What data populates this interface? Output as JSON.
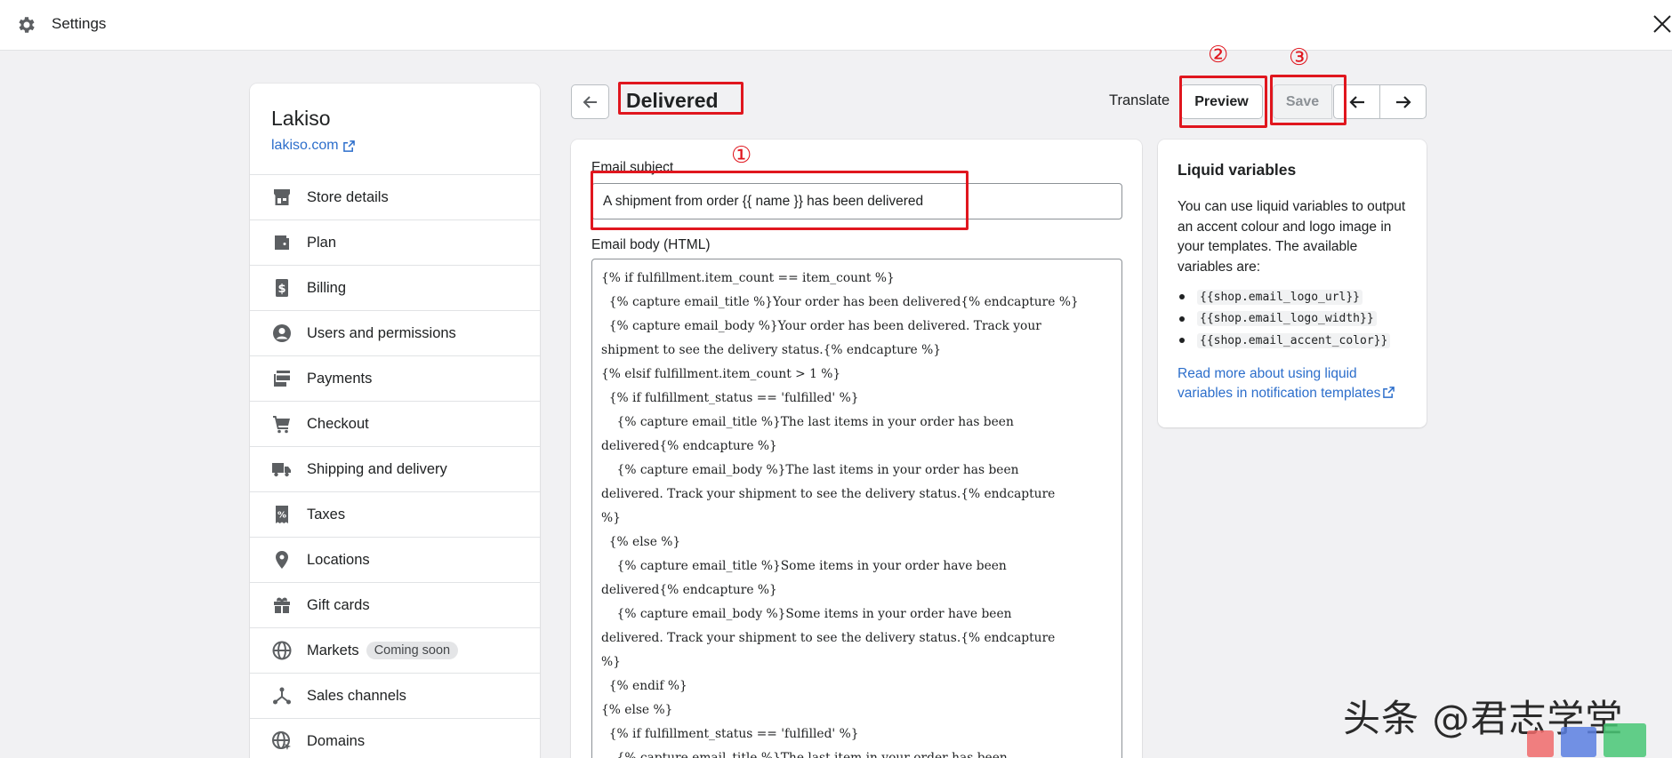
{
  "topbar": {
    "title": "Settings"
  },
  "sidebar": {
    "store_name": "Lakiso",
    "store_link": "lakiso.com",
    "items": [
      {
        "label": "Store details",
        "icon": "store-icon"
      },
      {
        "label": "Plan",
        "icon": "wallet-icon"
      },
      {
        "label": "Billing",
        "icon": "dollar-icon"
      },
      {
        "label": "Users and permissions",
        "icon": "user-icon"
      },
      {
        "label": "Payments",
        "icon": "payments-icon"
      },
      {
        "label": "Checkout",
        "icon": "cart-icon"
      },
      {
        "label": "Shipping and delivery",
        "icon": "truck-icon"
      },
      {
        "label": "Taxes",
        "icon": "tax-icon"
      },
      {
        "label": "Locations",
        "icon": "location-icon"
      },
      {
        "label": "Gift cards",
        "icon": "gift-icon"
      },
      {
        "label": "Markets",
        "icon": "globe-icon",
        "badge": "Coming soon"
      },
      {
        "label": "Sales channels",
        "icon": "channels-icon"
      },
      {
        "label": "Domains",
        "icon": "domain-icon"
      }
    ]
  },
  "header": {
    "title": "Delivered",
    "translate_label": "Translate",
    "preview_label": "Preview",
    "save_label": "Save"
  },
  "main": {
    "subject_label": "Email subject",
    "subject_value": "A shipment from order {{ name }} has been delivered",
    "body_label": "Email body (HTML)",
    "body_lines": [
      "{% if fulfillment.item_count == item_count %}",
      "  {% capture email_title %}Your order has been delivered{% endcapture %}",
      "  {% capture email_body %}Your order has been delivered. Track your",
      "shipment to see the delivery status.{% endcapture %}",
      "{% elsif fulfillment.item_count > 1 %}",
      "  {% if fulfillment_status == 'fulfilled' %}",
      "    {% capture email_title %}The last items in your order has been",
      "delivered{% endcapture %}",
      "    {% capture email_body %}The last items in your order has been",
      "delivered. Track your shipment to see the delivery status.{% endcapture",
      "%}",
      "  {% else %}",
      "    {% capture email_title %}Some items in your order have been",
      "delivered{% endcapture %}",
      "    {% capture email_body %}Some items in your order have been",
      "delivered. Track your shipment to see the delivery status.{% endcapture",
      "%}",
      "  {% endif %}",
      "{% else %}",
      "  {% if fulfillment_status == 'fulfilled' %}",
      "    {% capture email_title %}The last item in your order has been"
    ]
  },
  "liquid": {
    "title": "Liquid variables",
    "description": "You can use liquid variables to output an accent colour and logo image in your templates. The available variables are:",
    "variables": [
      "{{shop.email_logo_url}}",
      "{{shop.email_logo_width}}",
      "{{shop.email_accent_color}}"
    ],
    "link": "Read more about using liquid variables in notification templates"
  },
  "annotations": [
    "①",
    "②",
    "③"
  ],
  "watermark": {
    "text": "头条 @君志学堂"
  },
  "colors": {
    "accent_link": "#2c6ecb",
    "annotation": "#e0161e",
    "background": "#f1f1f3"
  }
}
